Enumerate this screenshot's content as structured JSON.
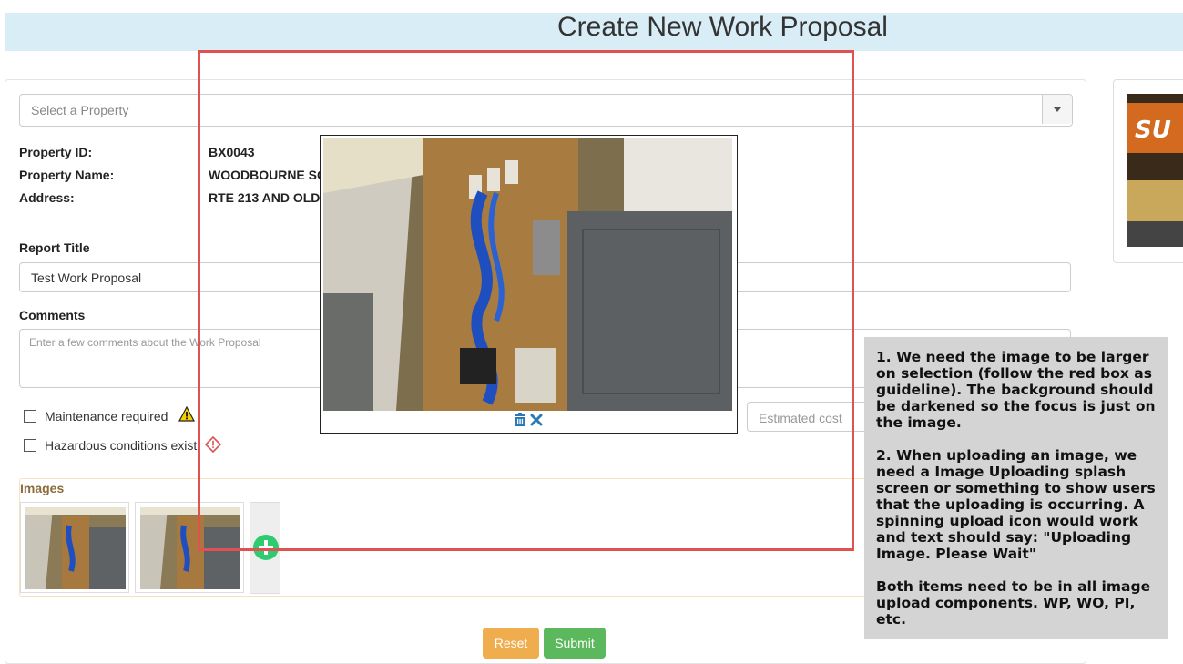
{
  "header": {
    "title": "Create New Work Proposal"
  },
  "property_select": {
    "placeholder": "Select a Property"
  },
  "property_info": {
    "id_label": "Property ID:",
    "id_value": "BX0043",
    "name_label": "Property Name:",
    "name_value": "WOODBOURNE SC",
    "address_label": "Address:",
    "address_value": "RTE 213 AND OLD"
  },
  "report_title": {
    "label": "Report Title",
    "value": "Test Work Proposal"
  },
  "comments": {
    "label": "Comments",
    "placeholder": "Enter a few comments about the Work Proposal"
  },
  "estimated_cost": {
    "placeholder": "Estimated cost"
  },
  "checkboxes": [
    {
      "label": "Maintenance required",
      "checked": false,
      "icon": "warning-triangle-icon"
    },
    {
      "label": "Hazardous conditions exist",
      "checked": false,
      "icon": "hazard-diamond-icon"
    }
  ],
  "images": {
    "label": "Images",
    "count": 2,
    "add_icon": "plus-circle-icon"
  },
  "modal": {
    "delete_icon": "trash-icon",
    "close_icon": "close-icon"
  },
  "buttons": {
    "reset": "Reset",
    "submit": "Submit"
  },
  "annotation": {
    "para1": "1. We need the image to be larger on selection (follow the red box as guideline). The background should be darkened so the focus is just on the image.",
    "para2": "2. When uploading an image, we need a Image Uploading splash screen or something to show users that the uploading is occurring. A spinning upload icon would work and text should say: \"Uploading Image. Please Wait\"",
    "para3": "Both items need to be in all image upload components.  WP, WO, PI, etc."
  },
  "colors": {
    "header_bg": "#d9edf7",
    "reset": "#f0ad4e",
    "submit": "#5cb85c",
    "annotation_bg": "#d4d4d4",
    "red_box": "#e05252",
    "images_label": "#8a6d3b",
    "add_icon": "#2ecc71"
  }
}
